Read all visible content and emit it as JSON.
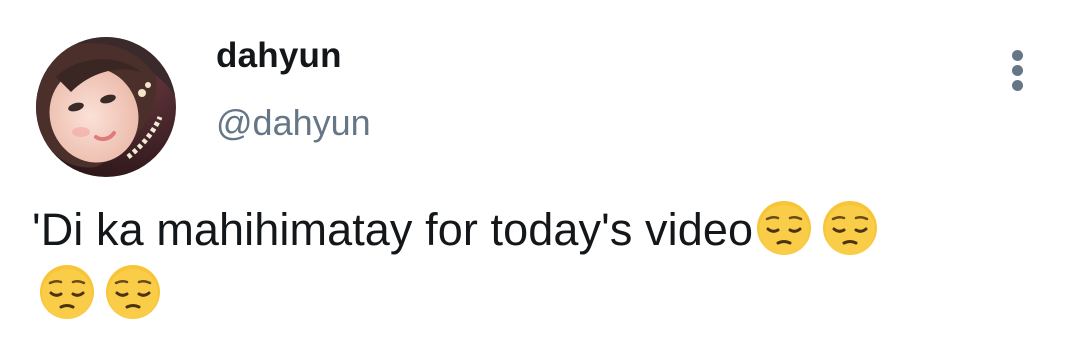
{
  "tweet": {
    "display_name": "dahyun",
    "handle": "@dahyun",
    "text": "'Di ka mahihimatay for today's video",
    "emojis": [
      "pensive-face-emoji",
      "pensive-face-emoji",
      "pensive-face-emoji",
      "pensive-face-emoji"
    ],
    "more_icon": "more-vertical-icon"
  },
  "colors": {
    "name_text": "#14171a",
    "handle_text": "#657786",
    "emoji_face": "#f7c537"
  }
}
